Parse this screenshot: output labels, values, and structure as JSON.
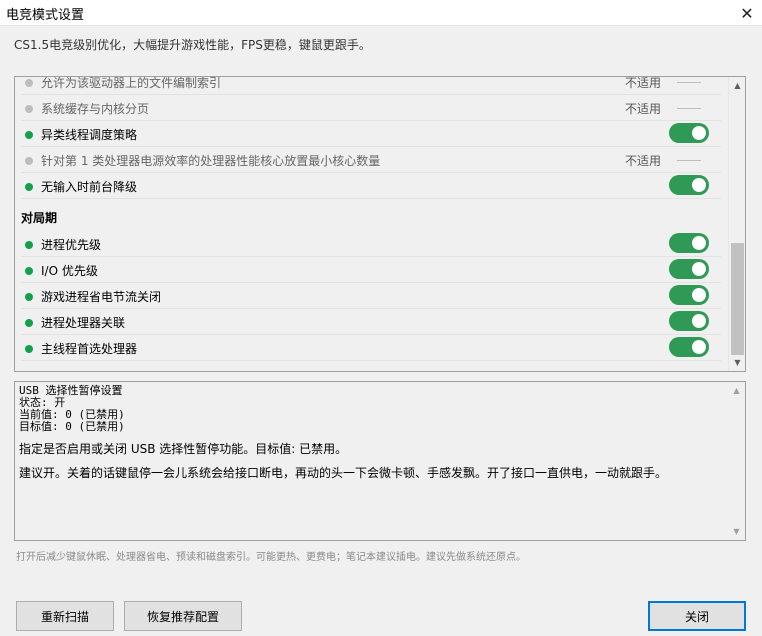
{
  "window": {
    "title": "电竞模式设置",
    "close_icon": "close-icon"
  },
  "subtitle": "CS1.5电竞级别优化，大幅提升游戏性能，FPS更稳，键鼠更跟手。",
  "list": {
    "rows_top": [
      {
        "label": "允许为该驱动器上的文件编制索引",
        "status": "na",
        "na_text": "不适用"
      },
      {
        "label": "系统缓存与内核分页",
        "status": "na",
        "na_text": "不适用"
      },
      {
        "label": "异类线程调度策略",
        "status": "on"
      },
      {
        "label": "针对第 1 类处理器电源效率的处理器性能核心放置最小核心数量",
        "status": "na",
        "na_text": "不适用"
      },
      {
        "label": "无输入时前台降级",
        "status": "on"
      }
    ],
    "section_title": "对局期",
    "rows_bottom": [
      {
        "label": "进程优先级",
        "status": "on"
      },
      {
        "label": "I/O 优先级",
        "status": "on"
      },
      {
        "label": "游戏进程省电节流关闭",
        "status": "on"
      },
      {
        "label": "进程处理器关联",
        "status": "on"
      },
      {
        "label": "主线程首选处理器",
        "status": "on"
      }
    ],
    "colors": {
      "on_dot": "#12a04a",
      "na_dot": "#bdbdbd",
      "toggle_on": "#2f9a55"
    }
  },
  "detail": {
    "line1": "USB 选择性暂停设置",
    "line2": "状态: 开",
    "line3": "当前值: 0 (已禁用)",
    "line4": "目标值: 0 (已禁用)",
    "para1": "指定是否启用或关闭 USB 选择性暂停功能。目标值: 已禁用。",
    "para2": "建议开。关着的话键鼠停一会儿系统会给接口断电，再动的头一下会微卡顿、手感发飘。开了接口一直供电，一动就跟手。"
  },
  "footnote": "打开后减少键鼠休眠、处理器省电、预读和磁盘索引。可能更热、更费电；笔记本建议插电。建议先做系统还原点。",
  "buttons": {
    "rescan": "重新扫描",
    "restore": "恢复推荐配置",
    "close": "关闭"
  }
}
